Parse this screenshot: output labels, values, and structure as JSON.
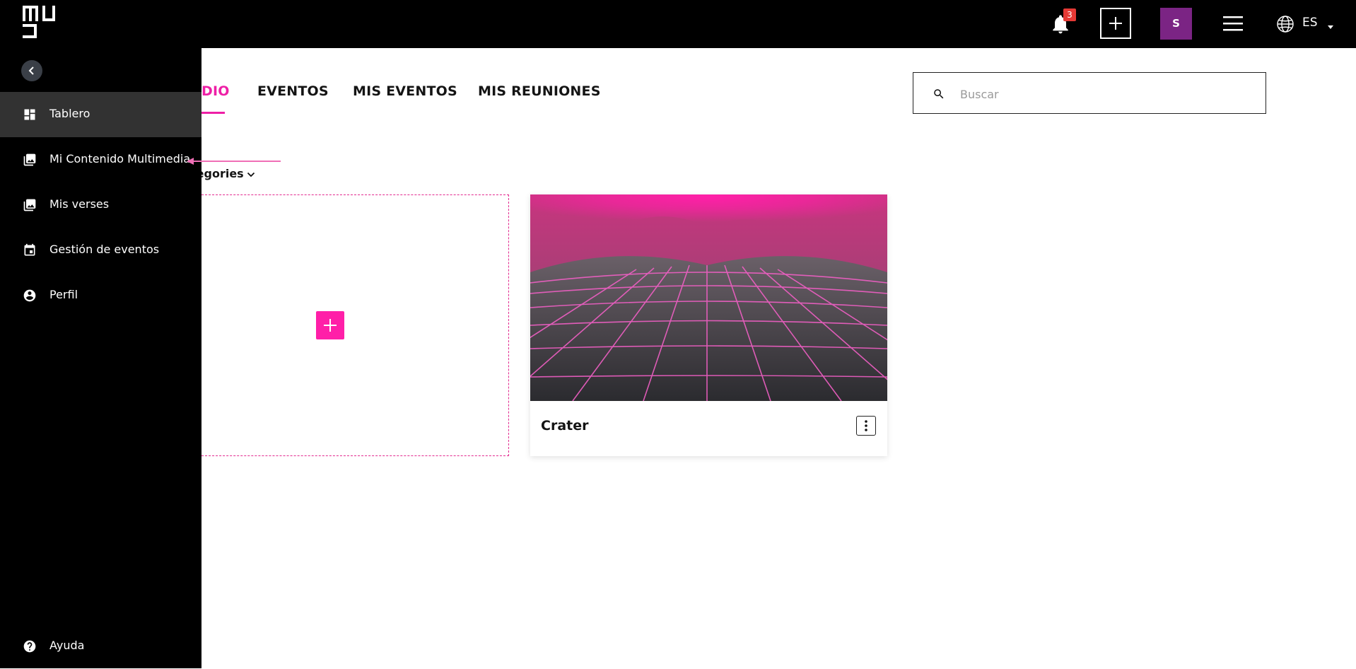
{
  "topbar": {
    "notifications_count": "3",
    "language": "ES",
    "avatar_initial": "S",
    "colors": {
      "background": "#000000",
      "avatar": "#7b2484",
      "badge": "#e53935"
    },
    "icons": [
      "logo-icon",
      "bell-icon",
      "plus-icon",
      "hamburger-icon",
      "globe-icon",
      "caret-down-icon"
    ]
  },
  "sidebar": {
    "items": [
      {
        "label": "Tablero",
        "icon": "dashboard-icon",
        "active": true
      },
      {
        "label": "Mi Contenido Multimedia",
        "icon": "media-library-icon",
        "active": false
      },
      {
        "label": "Mis verses",
        "icon": "photo-library-icon",
        "active": false
      },
      {
        "label": "Gestión de eventos",
        "icon": "calendar-icon",
        "active": false
      },
      {
        "label": "Perfil",
        "icon": "account-circle-icon",
        "active": false
      }
    ],
    "help_label": "Ayuda"
  },
  "main": {
    "tabs": [
      {
        "label": "DIO",
        "active": true
      },
      {
        "label": "EVENTOS",
        "active": false
      },
      {
        "label": "MIS EVENTOS",
        "active": false
      },
      {
        "label": "MIS REUNIONES",
        "active": false
      }
    ],
    "search": {
      "placeholder": "Buscar",
      "value": ""
    },
    "categories_label": "tegories",
    "verses": [
      {
        "title": "Crater"
      }
    ],
    "accent_color": "#ee1fa6"
  }
}
